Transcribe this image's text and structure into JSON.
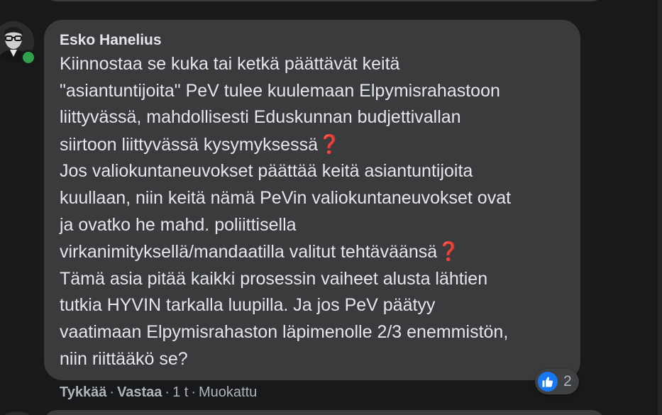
{
  "comment": {
    "author": "Esko Hanelius",
    "lines": [
      "Kiinnostaa se kuka tai ketkä päättävät keitä",
      "\"asiantuntijoita\" PeV tulee kuulemaan Elpymisrahastoon",
      "liittyvässä, mahdollisesti Eduskunnan budjettivallan",
      "siirtoon liittyvässä kysymyksessä",
      "Jos valiokuntaneuvokset päättää keitä asiantuntijoita",
      "kuullaan, niin keitä nämä PeVin valiokuntaneuvokset ovat",
      "ja ovatko he mahd. poliittisella",
      "virkanimityksellä/mandaatilla valitut tehtäväänsä",
      "Tämä asia pitää kaikki prosessin vaiheet alusta lähtien",
      "tutkia HYVIN tarkalla luupilla. Ja jos PeV päätyy",
      "vaatimaan Elpymisrahaston läpimenolle 2/3 enemmistön,",
      "niin riittääkö se?"
    ],
    "emoji": "❓",
    "online": true
  },
  "reactions": {
    "icon": "like-icon",
    "count": "2"
  },
  "actions": {
    "like": "Tykkää",
    "reply": "Vastaa",
    "separator": "·",
    "time": "1 t",
    "edited": "Muokattu"
  },
  "colors": {
    "background": "#18191a",
    "bubble": "#3a3b3c",
    "text": "#e4e6eb",
    "secondary_text": "#b0b3b8",
    "online": "#31a24c",
    "like": "#1877f2",
    "emoji_red": "#e0314b"
  }
}
